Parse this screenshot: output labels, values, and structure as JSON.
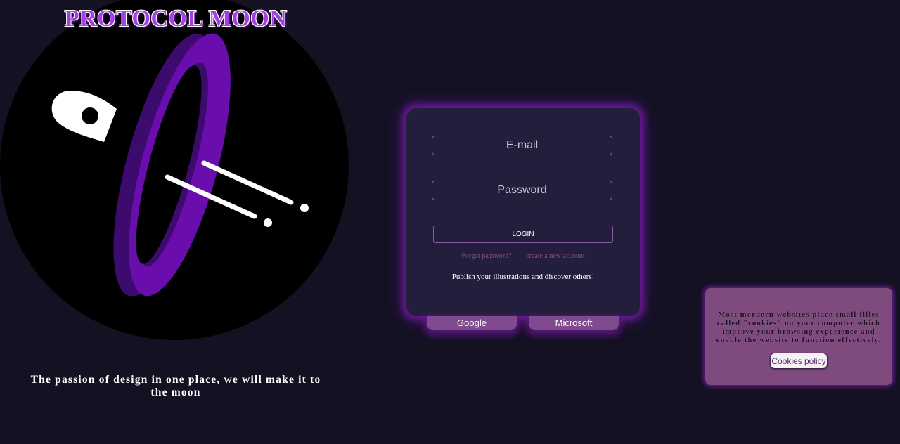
{
  "brand": {
    "title": "PROTOCOL MOON",
    "tagline": "The passion of design in one place, we will make it to the moon"
  },
  "login": {
    "email_placeholder": "E-mail",
    "password_placeholder": "Password",
    "login_label": "LOGIN",
    "forgot_password": "Forgot password?",
    "create_account": "create a new account",
    "publish_text": "Publish your illustrations and discover others!"
  },
  "social": {
    "google_label": "Google",
    "microsoft_label": "Microsoft"
  },
  "cookies": {
    "message": "Most mordern websites place small filles called \"cookies\" on your computer which improve your browsing experience and enable the website to function effectively.",
    "policy_label": "Cookies policy"
  },
  "colors": {
    "background": "#131122",
    "card": "#221e3b",
    "accent_purple": "#6a0dad",
    "glow": "#7a1eaa",
    "cookie_banner": "#7f4a7d",
    "social_button": "#7f4a8e",
    "link": "#8b4f86"
  }
}
